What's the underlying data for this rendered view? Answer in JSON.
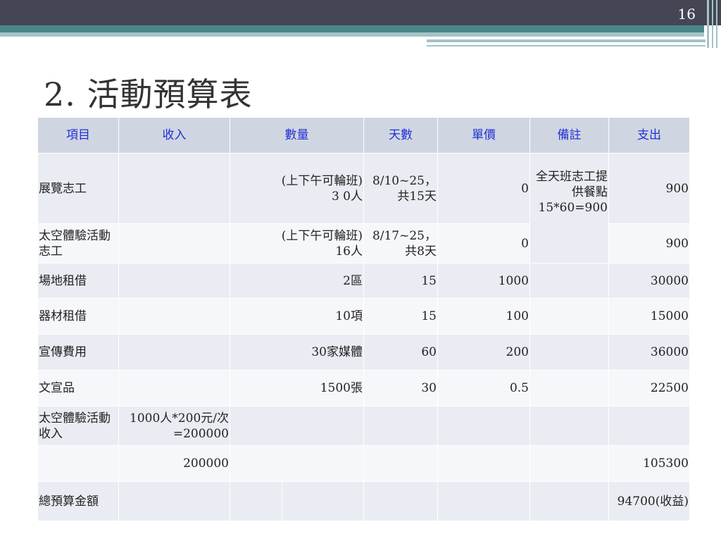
{
  "slide_number": "16",
  "title": "2. 活動預算表",
  "colors": {
    "header_bar": "#454655",
    "teal_bar": "#4b8589",
    "header_row_bg": "#d0d6e1",
    "header_text": "#2130d6"
  },
  "table": {
    "headers": [
      "項目",
      "收入",
      "數量",
      "天數",
      "單價",
      "備註",
      "支出"
    ],
    "rows": [
      {
        "item": "展覽志工",
        "income": "",
        "qty": "(上下午可輪班)\n3 0人",
        "days": "8/10~25，\n共15天",
        "price": "0",
        "note": "全天班志工提供餐點\n15*60=900",
        "expense": "900"
      },
      {
        "item": "太空體驗活動志工",
        "income": "",
        "qty": "(上下午可輪班)\n16人",
        "days": "8/17~25，\n共8天",
        "price": "0",
        "expense": "900"
      },
      {
        "item": "場地租借",
        "income": "",
        "qty": "2區",
        "days": "15",
        "price": "1000",
        "note": "",
        "expense": "30000"
      },
      {
        "item": "器材租借",
        "income": "",
        "qty": "10項",
        "days": "15",
        "price": "100",
        "note": "",
        "expense": "15000"
      },
      {
        "item": "宣傳費用",
        "income": "",
        "qty": "30家媒體",
        "days": "60",
        "price": "200",
        "note": "",
        "expense": "36000"
      },
      {
        "item": "文宣品",
        "income": "",
        "qty": "1500張",
        "days": "30",
        "price": "0.5",
        "note": "",
        "expense": "22500"
      },
      {
        "item": "太空體驗活動收入",
        "income": "1000人*200元/次=200000",
        "qty": "",
        "days": "",
        "price": "",
        "note": "",
        "expense": ""
      },
      {
        "item": "",
        "income": "200000",
        "qty": "",
        "days": "",
        "price": "",
        "note": "",
        "expense": "105300"
      },
      {
        "item": "總預算金額",
        "income": "",
        "qty": "",
        "days": "",
        "price": "",
        "note": "",
        "expense": "94700(收益)"
      }
    ]
  }
}
